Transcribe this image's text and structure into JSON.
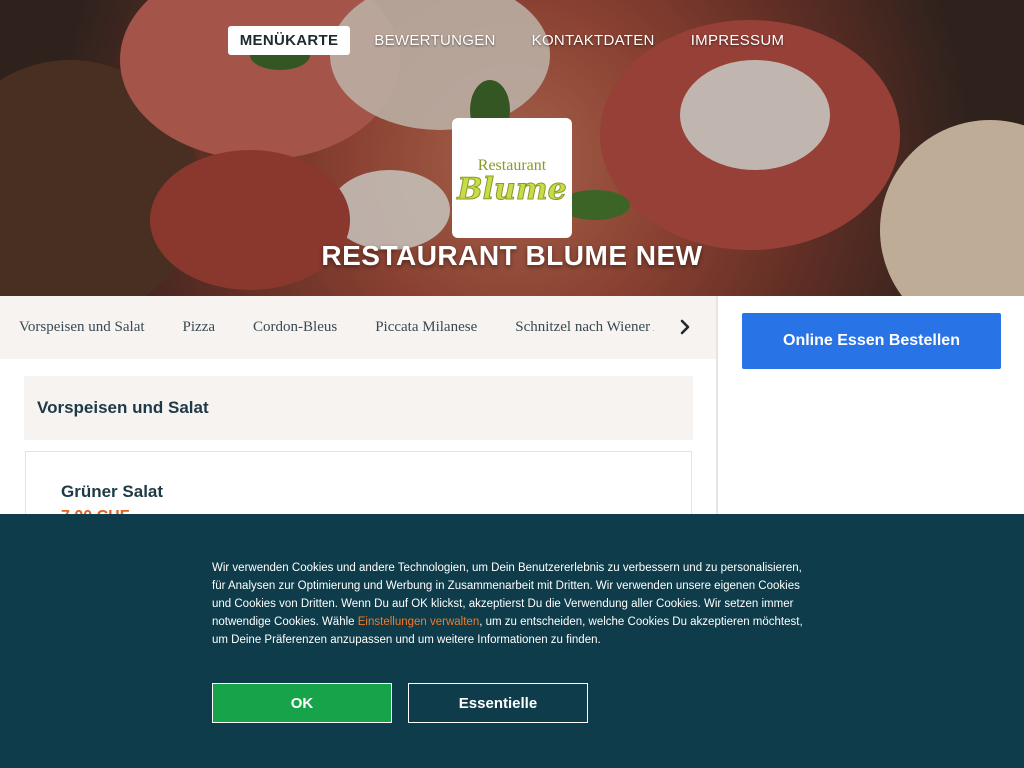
{
  "nav": {
    "items": [
      {
        "label": "MENÜKARTE",
        "active": true
      },
      {
        "label": "BEWERTUNGEN",
        "active": false
      },
      {
        "label": "KONTAKTDATEN",
        "active": false
      },
      {
        "label": "IMPRESSUM",
        "active": false
      }
    ]
  },
  "logo": {
    "line1": "Restaurant",
    "line2": "Blume"
  },
  "hero": {
    "title": "RESTAURANT BLUME NEW"
  },
  "categories": {
    "items": [
      "Vorspeisen und Salat",
      "Pizza",
      "Cordon-Bleus",
      "Piccata Milanese",
      "Schnitzel nach Wiener Art"
    ],
    "next_icon": "chevron-right-icon"
  },
  "section": {
    "title": "Vorspeisen und Salat"
  },
  "menu_item": {
    "name": "Grüner Salat",
    "price": "7.00 CHF"
  },
  "side": {
    "order_button": "Online Essen Bestellen"
  },
  "cookie": {
    "text_before": "Wir verwenden Cookies und andere Technologien, um Dein Benutzererlebnis zu verbessern und zu personalisieren, für Analysen zur Optimierung und Werbung in Zusammenarbeit mit Dritten. Wir verwenden unsere eigenen Cookies und Cookies von Dritten. Wenn Du auf OK klickst, akzeptierst Du die Verwendung aller Cookies. Wir setzen immer notwendige Cookies. Wähle ",
    "link": "Einstellungen verwalten",
    "text_after": ", um zu entscheiden, welche Cookies Du akzeptieren möchtest, um Deine Präferenzen anzupassen und um weitere Informationen zu finden.",
    "ok_label": "OK",
    "essential_label": "Essentielle"
  },
  "colors": {
    "accent_blue": "#2873e6",
    "price_orange": "#e2611c",
    "banner_bg": "#0e3c4a",
    "ok_green": "#16a34a"
  }
}
